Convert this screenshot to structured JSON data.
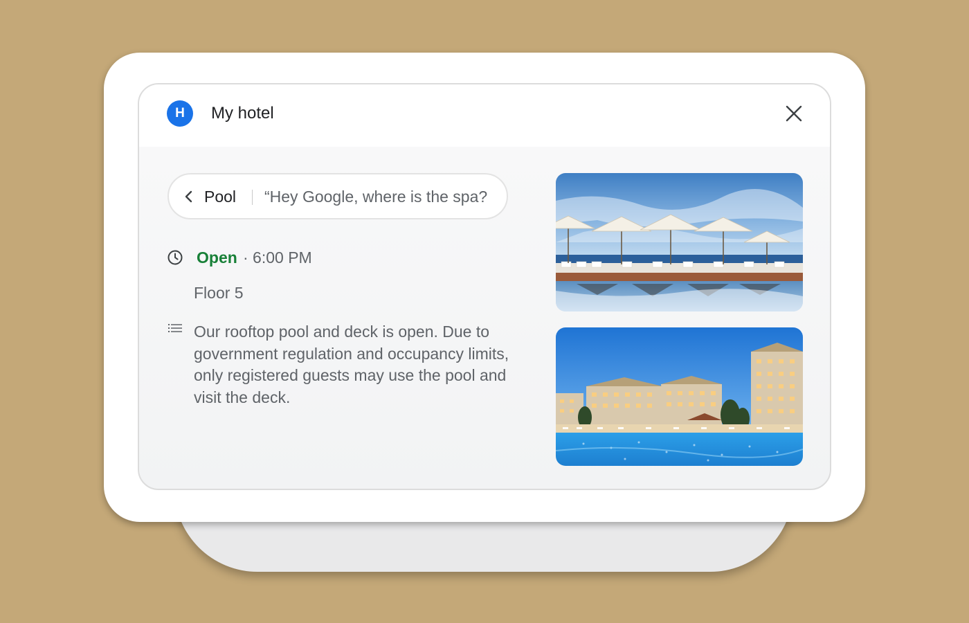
{
  "app": {
    "avatar_letter": "H",
    "title": "My hotel"
  },
  "query_chip": {
    "label": "Pool",
    "query": "“Hey Google, where is the spa?"
  },
  "hours": {
    "status": "Open",
    "separator_time": "· 6:00 PM"
  },
  "floor": "Floor 5",
  "description": "Our rooftop pool and deck is open. Due to government regulation and occupancy limits, only registered guests may use the pool and visit the deck.",
  "icons": {
    "close": "close-icon",
    "back": "chevron-left-icon",
    "clock": "clock-icon",
    "description": "notes-icon"
  },
  "colors": {
    "background": "#c4a878",
    "avatar": "#1a73e8",
    "open_status": "#188038",
    "secondary_text": "#5f6368",
    "primary_text": "#202124"
  }
}
